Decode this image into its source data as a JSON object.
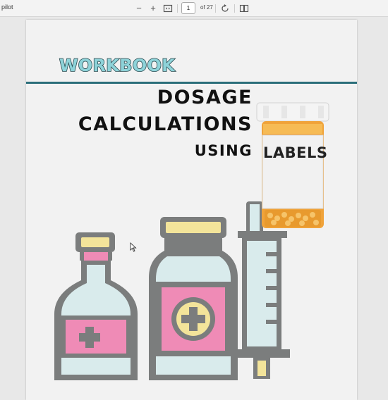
{
  "viewer": {
    "app_title": "pilot",
    "zoom_out_glyph": "−",
    "zoom_in_glyph": "+",
    "current_page": "1",
    "total_pages": "of 27",
    "icons": [
      "zoom-out-icon",
      "zoom-in-icon",
      "fit-page-icon",
      "rotate-icon",
      "two-page-icon"
    ]
  },
  "cover": {
    "workbook_label": "WORKBOOK",
    "title_line1": "DOSAGE",
    "title_line2": "CALCULATIONS",
    "title_line3": "USING",
    "bottle_label": "LABELS"
  },
  "colors": {
    "workbook_fill": "#8ed3d9",
    "workbook_outline": "#28494f",
    "rule": "#2b6e7a",
    "outline_gray": "#7b7d7d",
    "vial_pink": "#ef8bb6",
    "vial_glass": "#d9ebec",
    "cap_yellow": "#f3e49a",
    "bottle_orange": "#f0a33a",
    "cap_white": "#f4f4f4"
  }
}
